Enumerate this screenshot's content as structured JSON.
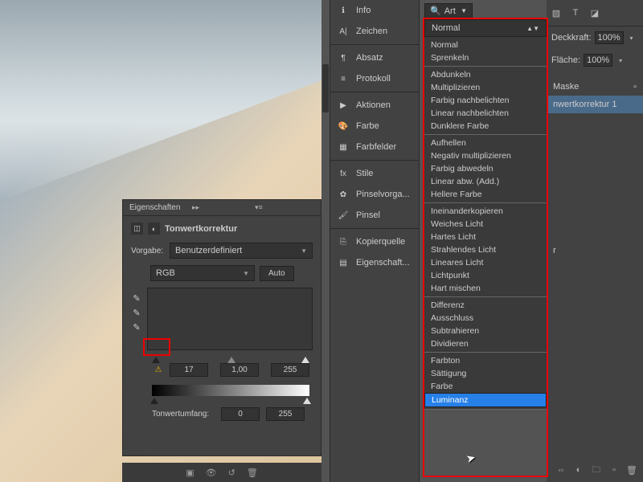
{
  "props": {
    "title": "Eigenschaften",
    "adjName": "Tonwertkorrektur",
    "presetLbl": "Vorgabe:",
    "preset": "Benutzerdefiniert",
    "channel": "RGB",
    "auto": "Auto",
    "in": [
      "17",
      "1,00",
      "255"
    ],
    "outLbl": "Tonwertumfang:",
    "out": [
      "0",
      "255"
    ]
  },
  "mid": {
    "items": [
      [
        "ℹ",
        "Info"
      ],
      [
        "A|",
        "Zeichen"
      ],
      [
        "¶",
        "Absatz"
      ],
      [
        "≡",
        "Protokoll"
      ],
      [
        "▶",
        "Aktionen"
      ],
      [
        "🎨",
        "Farbe"
      ],
      [
        "▦",
        "Farbfelder"
      ],
      [
        "fx",
        "Stile"
      ],
      [
        "✿",
        "Pinselvorga..."
      ],
      [
        "🖌",
        "Pinsel"
      ],
      [
        "⎘",
        "Kopierquelle"
      ],
      [
        "▤",
        "Eigenschaft..."
      ]
    ]
  },
  "right": {
    "search": "Art",
    "opacLbl": "Deckkraft:",
    "opac": "100%",
    "fillLbl": "Fläche:",
    "fill": "100%",
    "maskLbl": "Maske",
    "layer": "nwertkorrektur 1",
    "layer2": "r"
  },
  "dd": {
    "current": "Normal",
    "groups": [
      [
        "Normal",
        "Sprenkeln"
      ],
      [
        "Abdunkeln",
        "Multiplizieren",
        "Farbig nachbelichten",
        "Linear nachbelichten",
        "Dunklere Farbe"
      ],
      [
        "Aufhellen",
        "Negativ multiplizieren",
        "Farbig abwedeln",
        "Linear abw. (Add.)",
        "Hellere Farbe"
      ],
      [
        "Ineinanderkopieren",
        "Weiches Licht",
        "Hartes Licht",
        "Strahlendes Licht",
        "Lineares Licht",
        "Lichtpunkt",
        "Hart mischen"
      ],
      [
        "Differenz",
        "Ausschluss",
        "Subtrahieren",
        "Dividieren"
      ],
      [
        "Farbton",
        "Sättigung",
        "Farbe",
        "Luminanz"
      ]
    ],
    "selected": "Luminanz"
  }
}
